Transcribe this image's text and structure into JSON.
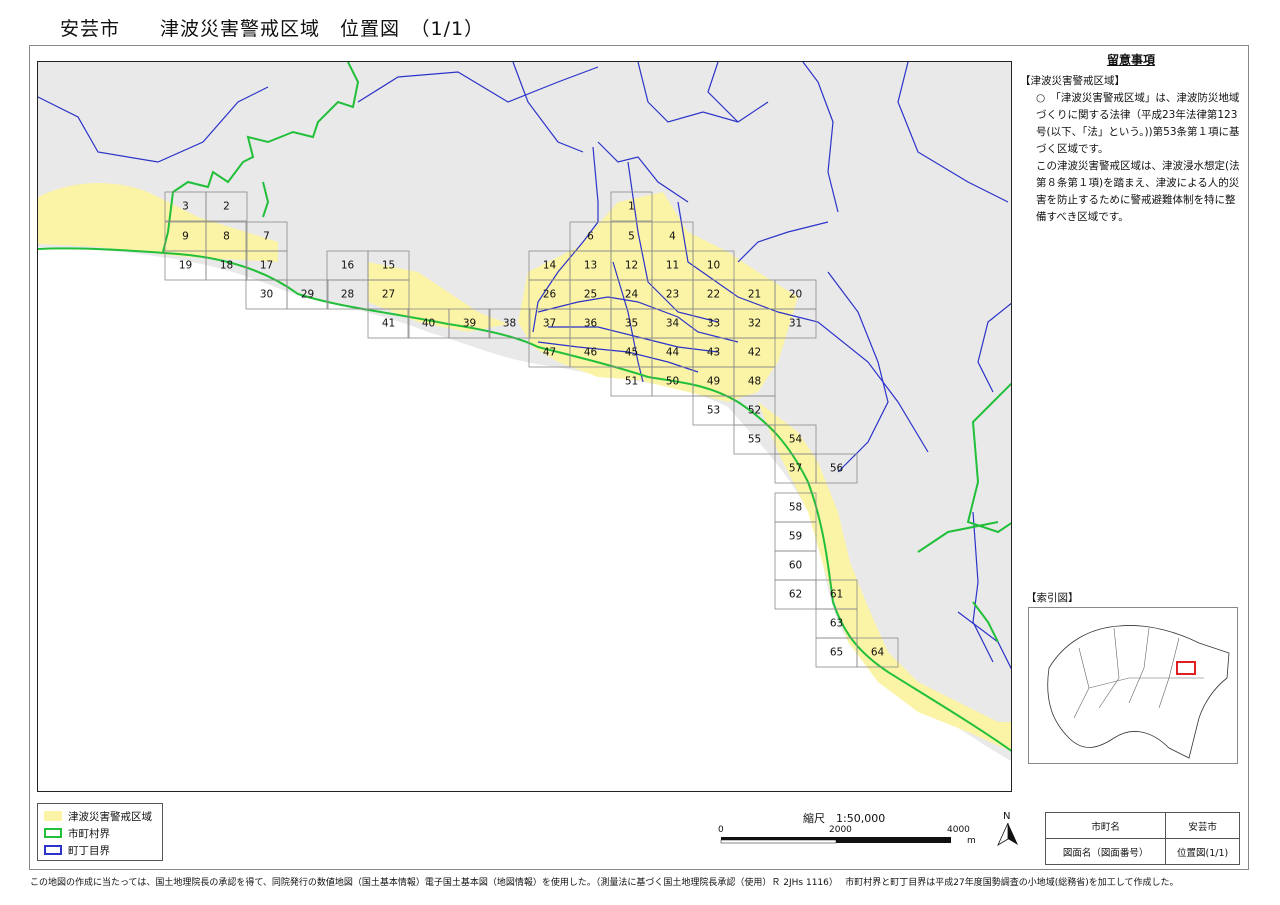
{
  "title": "安芸市　　津波災害警戒区域　位置図　（1/1）",
  "notes": {
    "heading": "留意事項",
    "subheading": "【津波災害警戒区域】",
    "para1": "○　「津波災害警戒区域」は、津波防災地域づくりに関する法律（平成23年法律第123号(以下、「法」という。))第53条第１項に基づく区域です。",
    "para2": "この津波災害警戒区域は、津波浸水想定(法第８条第１項)を踏まえ、津波による人的災害を防止するために警戒避難体制を特に整備すべき区域です。"
  },
  "index_map": {
    "label": "【索引図】"
  },
  "legend": {
    "items": [
      {
        "label": "津波災害警戒区域",
        "color": "#fbf3a6"
      },
      {
        "label": "市町村界",
        "color": "#22c03a"
      },
      {
        "label": "町丁目界",
        "color": "#2b33c9"
      }
    ]
  },
  "scale": {
    "label": "縮尺　1:50,000",
    "ticks": [
      "0",
      "2000",
      "4000"
    ],
    "unit": "m"
  },
  "north": {
    "label": "N"
  },
  "info_table": {
    "rows": [
      {
        "key": "市町名",
        "value": "安芸市"
      },
      {
        "key": "図面名（図面番号）",
        "value": "位置図(1/1)"
      }
    ]
  },
  "footer": "この地図の作成に当たっては、国土地理院長の承認を得て、同院発行の数値地図（国土基本情報）電子国土基本図（地図情報）を使用した。（測量法に基づく国土地理院長承認（使用）Ｒ 2JHs 1116）　 市町村界と町丁目界は平成27年度国勢調査の小地域(総務省)を加工して作成した。",
  "map_sheets": [
    "1",
    "2",
    "3",
    "4",
    "5",
    "6",
    "7",
    "8",
    "9",
    "10",
    "11",
    "12",
    "13",
    "14",
    "15",
    "16",
    "17",
    "18",
    "19",
    "20",
    "21",
    "22",
    "23",
    "24",
    "25",
    "26",
    "27",
    "28",
    "29",
    "30",
    "31",
    "32",
    "33",
    "34",
    "35",
    "36",
    "37",
    "38",
    "39",
    "40",
    "41",
    "42",
    "43",
    "44",
    "45",
    "46",
    "47",
    "48",
    "49",
    "50",
    "51",
    "52",
    "53",
    "54",
    "55",
    "56",
    "57",
    "58",
    "59",
    "60",
    "61",
    "62",
    "63",
    "64",
    "65"
  ],
  "colors": {
    "zone": "#fbf3a6",
    "city_boundary": "#22c03a",
    "town_boundary": "#2b33c9",
    "index_highlight": "#e02020"
  }
}
